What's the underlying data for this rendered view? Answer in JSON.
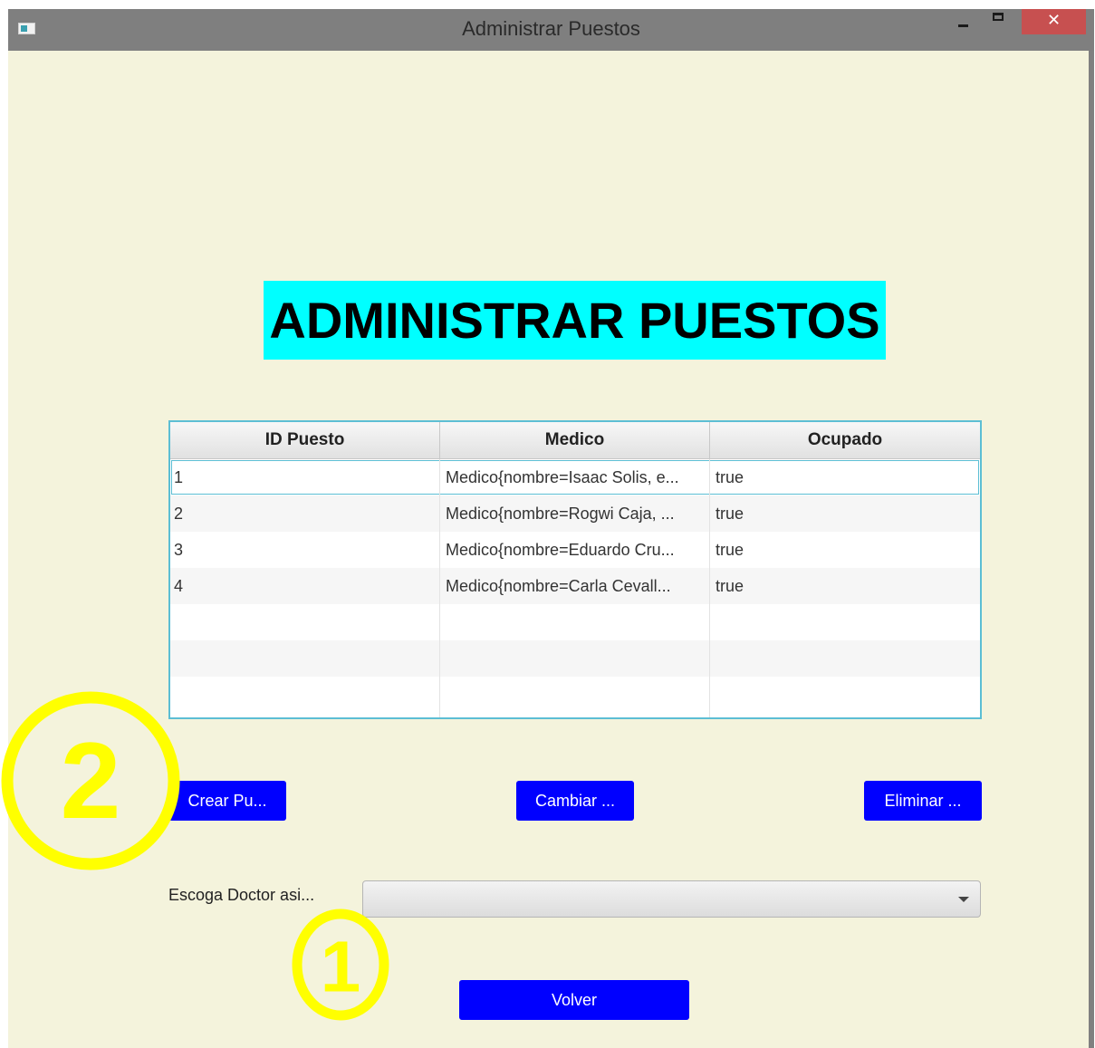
{
  "window": {
    "title": "Administrar Puestos",
    "close_glyph": "✕"
  },
  "heading": "ADMINISTRAR PUESTOS",
  "table": {
    "columns": [
      "ID Puesto",
      "Medico",
      "Ocupado"
    ],
    "rows": [
      [
        "1",
        "Medico{nombre=Isaac Solis, e...",
        "true"
      ],
      [
        "2",
        "Medico{nombre=Rogwi Caja, ...",
        "true"
      ],
      [
        "3",
        "Medico{nombre=Eduardo Cru...",
        "true"
      ],
      [
        "4",
        "Medico{nombre=Carla Cevall...",
        "true"
      ]
    ]
  },
  "buttons": {
    "crear": "Crear Pu...",
    "cambiar": "Cambiar ...",
    "eliminar": "Eliminar ...",
    "volver": "Volver"
  },
  "combo": {
    "label": "Escoga Doctor asi...",
    "value": ""
  },
  "annotations": {
    "circle_1": "1",
    "circle_2": "2",
    "color": "#ffff00"
  },
  "colors": {
    "background": "#f4f3dc",
    "heading_bg": "#00ffff",
    "button_bg": "#0000ff",
    "close_bg": "#c75050"
  }
}
